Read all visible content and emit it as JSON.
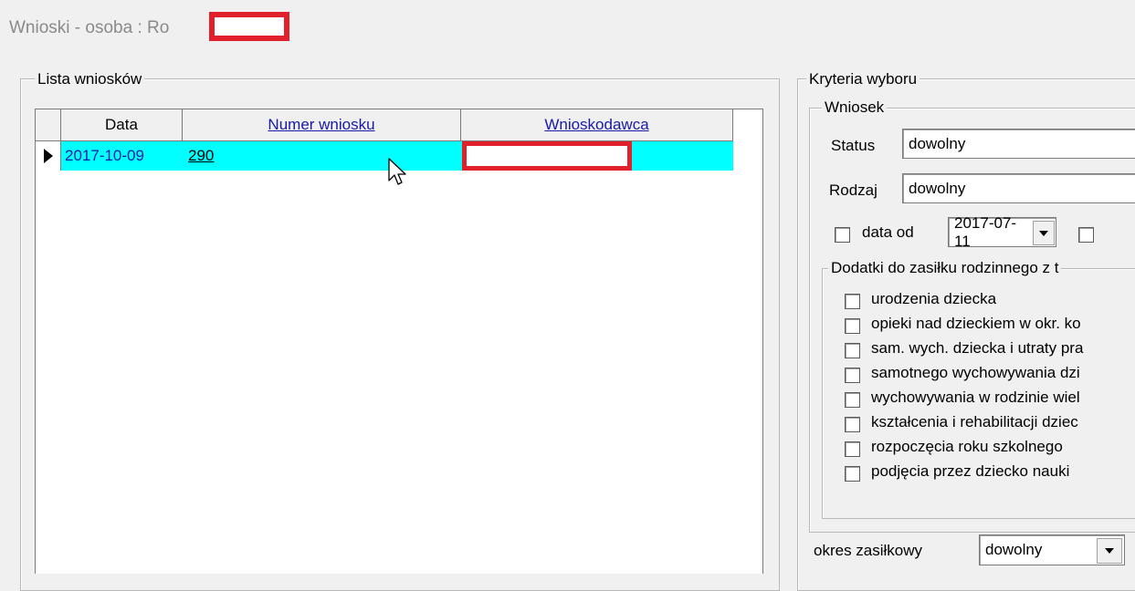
{
  "window": {
    "title": "Wnioski - osoba : Ro"
  },
  "list": {
    "legend": "Lista wniosków",
    "columns": [
      "Data",
      "Numer wniosku",
      "Wnioskodawca"
    ],
    "rows": [
      {
        "date": "2017-10-09",
        "number": "290",
        "applicant": ""
      }
    ]
  },
  "criteria": {
    "legend": "Kryteria wyboru",
    "wniosek": {
      "legend": "Wniosek",
      "status_label": "Status",
      "status_value": "dowolny",
      "rodzaj_label": "Rodzaj",
      "rodzaj_value": "dowolny",
      "date_from_label": "data od",
      "date_from_value": "2017-07-11"
    },
    "dodatki": {
      "legend": "Dodatki do zasiłku rodzinnego z t",
      "items": [
        "urodzenia dziecka",
        "opieki nad dzieckiem w okr. ko",
        "sam. wych. dziecka i utraty pra",
        "samotnego wychowywania dzi",
        "wychowywania w rodzinie wiel",
        "kształcenia i rehabilitacji dziec",
        "rozpoczęcia roku szkolnego",
        "podjęcia przez dziecko nauki"
      ]
    },
    "okres_label": "okres zasiłkowy",
    "okres_value": "dowolny"
  },
  "colors": {
    "selection": "#00ffff",
    "redaction": "#e0202a",
    "link": "#1a1aa8"
  }
}
